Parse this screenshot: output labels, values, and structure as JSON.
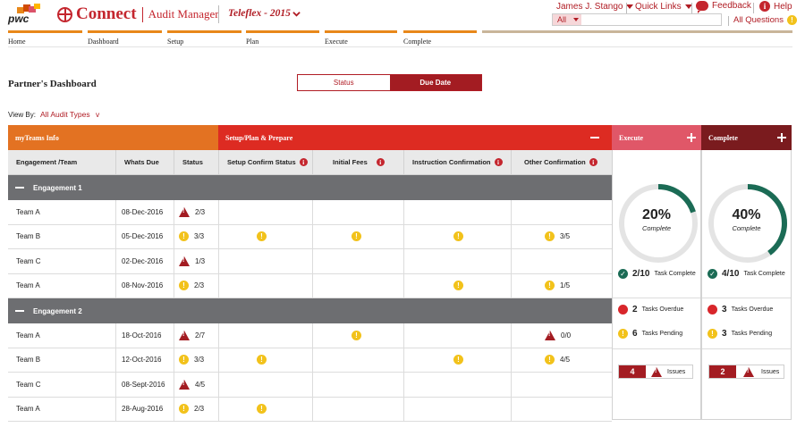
{
  "header": {
    "logo_text": "pwc",
    "brand_name": "Connect",
    "brand_sub": "Audit Manager",
    "client": "Teleflex - 2015",
    "user": "James J. Stango",
    "quick_links": "Quick Links",
    "feedback": "Feedback",
    "help": "Help",
    "search_scope": "All",
    "search_placeholder": "",
    "all_questions": "All Questions",
    "colors": {
      "brand": "#c4262e",
      "accent": "#e8881a"
    }
  },
  "steps": [
    "Home",
    "Dashboard",
    "Setup",
    "Plan",
    "Execute",
    "Complete"
  ],
  "page": {
    "title": "Partner's Dashboard",
    "toggle": {
      "status": "Status",
      "due_date": "Due Date"
    },
    "view_by_label": "View By:",
    "view_by_value": "All Audit Types"
  },
  "bands": {
    "myteams": "myTeams Info",
    "setup": "Setup/Plan & Prepare",
    "execute": "Execute",
    "complete": "Complete"
  },
  "columns": {
    "team": "Engagement /Team",
    "due": "Whats Due",
    "status": "Status",
    "setup_confirm": "Setup Confirm Status",
    "initial_fees": "Initial Fees",
    "instruction": "Instruction Confirmation",
    "other": "Other Confirmation"
  },
  "engagements": [
    {
      "name": "Engagement 1",
      "rows": [
        {
          "team": "Team A",
          "due": "08-Dec-2016",
          "status_icon": "alert-triangle",
          "status": "2/3",
          "setup": "",
          "fees": "",
          "instr": "",
          "other_icon": "",
          "other": ""
        },
        {
          "team": "Team B",
          "due": "05-Dec-2016",
          "status_icon": "warning",
          "status": "3/3",
          "setup": "warning",
          "fees": "warning",
          "instr": "warning",
          "other_icon": "warning",
          "other": "3/5"
        },
        {
          "team": "Team C",
          "due": "02-Dec-2016",
          "status_icon": "alert-triangle",
          "status": "1/3",
          "setup": "",
          "fees": "",
          "instr": "",
          "other_icon": "",
          "other": ""
        },
        {
          "team": "Team A",
          "due": "08-Nov-2016",
          "status_icon": "warning",
          "status": "2/3",
          "setup": "",
          "fees": "",
          "instr": "warning",
          "other_icon": "warning",
          "other": "1/5"
        }
      ]
    },
    {
      "name": "Engagement 2",
      "rows": [
        {
          "team": "Team A",
          "due": "18-Oct-2016",
          "status_icon": "alert-triangle",
          "status": "2/7",
          "setup": "",
          "fees": "warning",
          "instr": "",
          "other_icon": "alert-triangle",
          "other": "0/0"
        },
        {
          "team": "Team B",
          "due": "12-Oct-2016",
          "status_icon": "warning",
          "status": "3/3",
          "setup": "warning",
          "fees": "",
          "instr": "warning",
          "other_icon": "warning",
          "other": "4/5"
        },
        {
          "team": "Team C",
          "due": "08-Sept-2016",
          "status_icon": "alert-triangle",
          "status": "4/5",
          "setup": "",
          "fees": "",
          "instr": "",
          "other_icon": "",
          "other": ""
        },
        {
          "team": "Team A",
          "due": "28-Aug-2016",
          "status_icon": "warning",
          "status": "2/3",
          "setup": "warning",
          "fees": "",
          "instr": "",
          "other_icon": "",
          "other": ""
        }
      ]
    }
  ],
  "panels": {
    "execute": {
      "percent": "20%",
      "percent_value": 20,
      "complete_label": "Complete",
      "tasks_complete": "2/10",
      "tasks_complete_label": "Task Complete",
      "overdue": "2",
      "overdue_label": "Tasks Overdue",
      "pending": "6",
      "pending_label": "Tasks Pending",
      "issues": "4",
      "issues_label": "Issues"
    },
    "complete": {
      "percent": "40%",
      "percent_value": 40,
      "complete_label": "Complete",
      "tasks_complete": "4/10",
      "tasks_complete_label": "Task Complete",
      "overdue": "3",
      "overdue_label": "Tasks Overdue",
      "pending": "3",
      "pending_label": "Tasks Pending",
      "issues": "2",
      "issues_label": "Issues"
    }
  },
  "colors": {
    "orange_band": "#e37222",
    "red_band": "#dd2b22",
    "execute_band": "#e05768",
    "complete_band": "#7a1b1e",
    "ring_fill": "#1b6b55",
    "ring_track": "#e4e4e4",
    "warning": "#f2c21b",
    "alert": "#a31c22"
  }
}
